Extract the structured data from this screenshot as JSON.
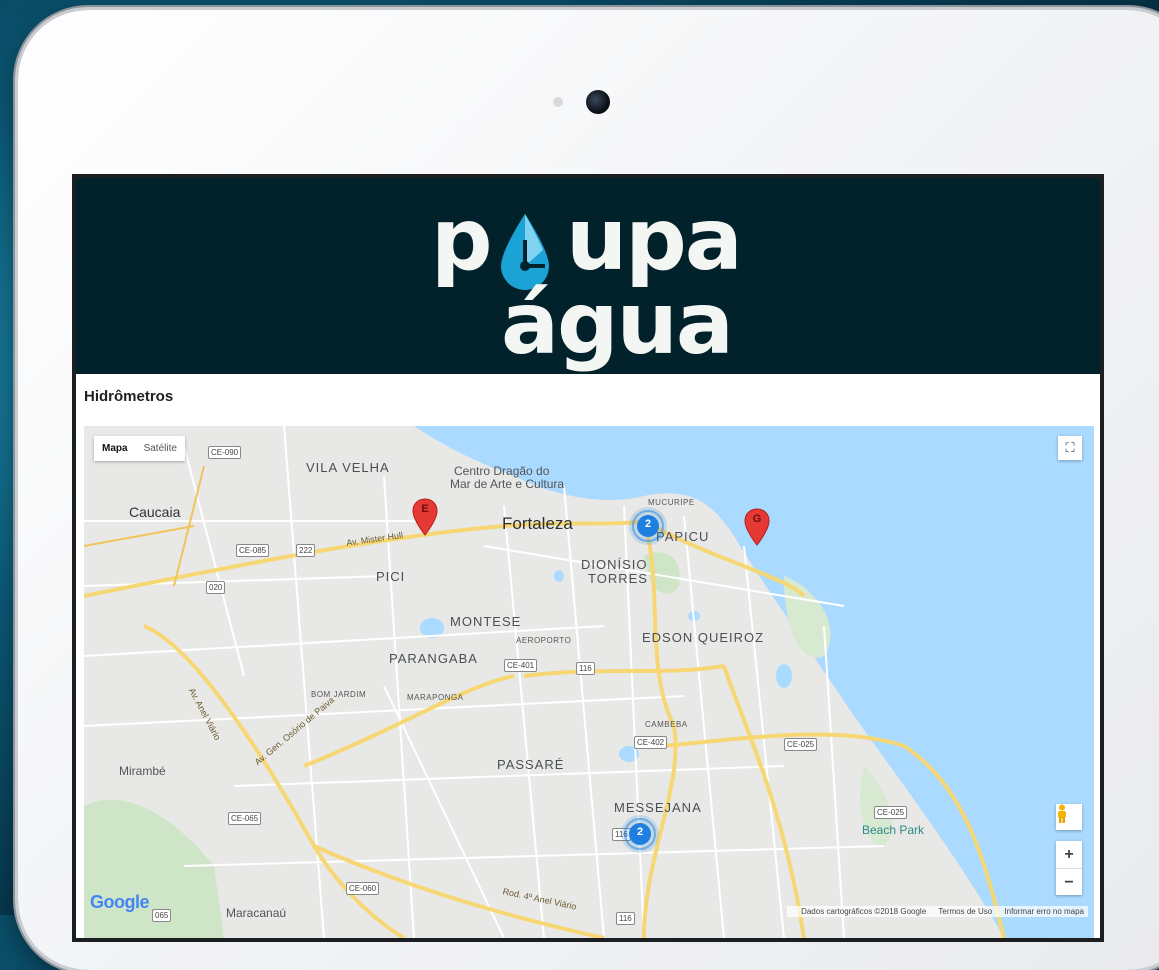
{
  "app": {
    "logo_line1_p": "p",
    "logo_line1_rest": "upa",
    "logo_line2": "água",
    "brand_color": "#02222b",
    "drop_color": "#1aa3d4"
  },
  "section": {
    "title": "Hidrômetros"
  },
  "map": {
    "map_type_map": "Mapa",
    "map_type_satellite": "Satélite",
    "google_logo": "Google",
    "attribution": "Dados cartográficos ©2018 Google",
    "terms": "Termos de Uso",
    "report": "Informar erro no mapa",
    "zoom_in": "+",
    "zoom_out": "−",
    "fullscreen_glyph": "⛶",
    "labels": {
      "vila_velha": "VILA VELHA",
      "centro_dragao": "Centro Dragão do",
      "centro_dragao2": "Mar de Arte e Cultura",
      "caucaia": "Caucaia",
      "fortaleza": "Fortaleza",
      "mucuripe": "MUCURIPE",
      "papicu": "PAPICU",
      "dionisio": "DIONÍSIO",
      "torres": "TORRES",
      "pici": "PICI",
      "montese": "MONTESE",
      "aeroporto": "AEROPORTO",
      "edson_queiroz": "EDSON QUEIROZ",
      "parangaba": "PARANGABA",
      "bom_jardim": "BOM JARDIM",
      "maraponga": "MARAPONGA",
      "cambeba": "CAMBEBA",
      "passare": "PASSARÉ",
      "mirambe": "Mirambé",
      "messejana": "MESSEJANA",
      "beach_park": "Beach Park",
      "maracanau": "Maracanaú",
      "av_mister_hull": "Av. Mister Hull",
      "av_anel_viario": "Av. Anel Viário",
      "av_gen_osorio": "Av. Gen. Osório de Paiva",
      "rod_anel_viario": "Rod. 4º Anel Viário"
    },
    "shields": {
      "ce090": "CE-090",
      "ce085": "CE-085",
      "r222": "222",
      "r020": "020",
      "ce401": "CE-401",
      "r116": "116",
      "ce402": "CE-402",
      "ce025a": "CE-025",
      "ce025b": "CE-025",
      "ce065": "CE-065",
      "ce060": "CE-060",
      "r116b": "116",
      "r065": "065",
      "r116c": "116"
    },
    "markers": {
      "e": "E",
      "g": "G",
      "cluster1": "2",
      "cluster2": "2",
      "pin_color": "#e53935",
      "cluster_color": "#1e7fe0"
    }
  }
}
